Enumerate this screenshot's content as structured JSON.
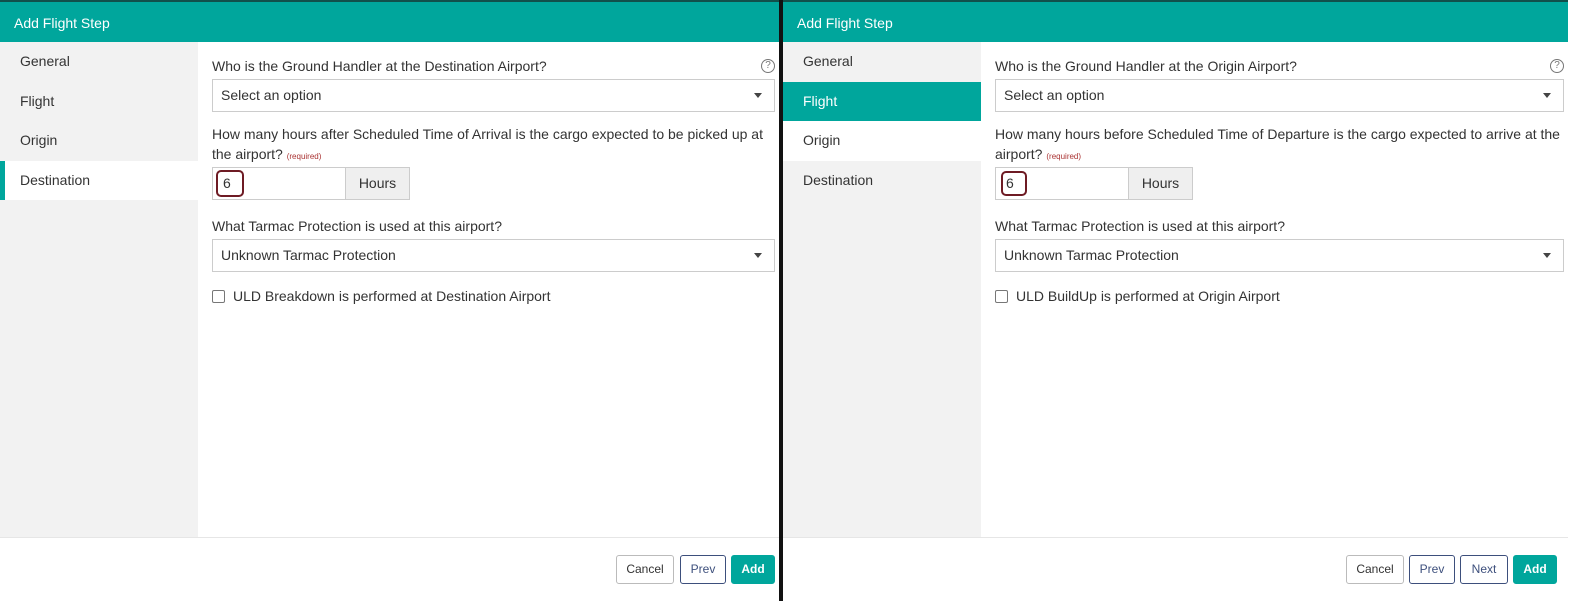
{
  "left": {
    "title": "Add Flight Step",
    "sidebar": [
      {
        "label": "General"
      },
      {
        "label": "Flight"
      },
      {
        "label": "Origin"
      },
      {
        "label": "Destination"
      }
    ],
    "q1": "Who is the Ground Handler at the Destination Airport?",
    "q1_select": "Select an option",
    "q2": "How many hours after Scheduled Time of Arrival is the cargo expected to be picked up at the airport?",
    "required": "(required)",
    "hours_value": "6",
    "hours_addon": "Hours",
    "q3": "What Tarmac Protection is used at this airport?",
    "q3_select": "Unknown Tarmac Protection",
    "checkbox_label": "ULD Breakdown is performed at Destination Airport",
    "help_icon": "?",
    "buttons": {
      "cancel": "Cancel",
      "prev": "Prev",
      "add": "Add"
    }
  },
  "right": {
    "title": "Add Flight Step",
    "sidebar": [
      {
        "label": "General"
      },
      {
        "label": "Flight"
      },
      {
        "label": "Origin"
      },
      {
        "label": "Destination"
      }
    ],
    "q1": "Who is the Ground Handler at the Origin Airport?",
    "q1_select": "Select an option",
    "q2": "How many hours before Scheduled Time of Departure is the cargo expected to arrive at the airport?",
    "required": "(required)",
    "hours_value": "6",
    "hours_addon": "Hours",
    "q3": "What Tarmac Protection is used at this airport?",
    "q3_select": "Unknown Tarmac Protection",
    "checkbox_label": "ULD BuildUp is performed at Origin Airport",
    "help_icon": "?",
    "buttons": {
      "cancel": "Cancel",
      "prev": "Prev",
      "next": "Next",
      "add": "Add"
    }
  },
  "colors": {
    "accent": "#00a69c",
    "highlight": "#6e1b24",
    "nav_border": "#3d4f7c"
  }
}
